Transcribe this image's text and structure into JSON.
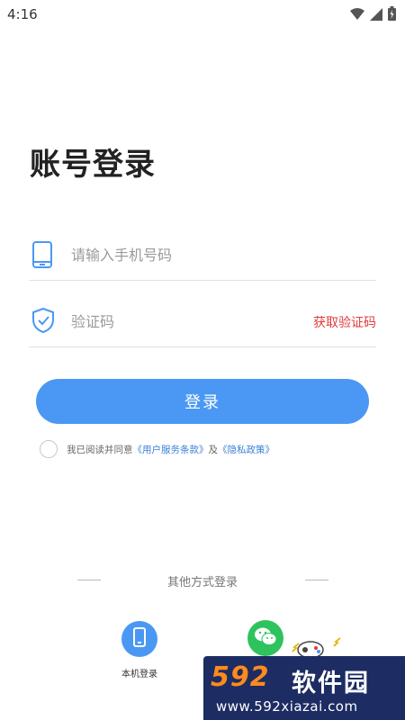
{
  "status_bar": {
    "time": "4:16"
  },
  "page": {
    "title": "账号登录"
  },
  "phone_field": {
    "placeholder": "请输入手机号码",
    "value": ""
  },
  "code_field": {
    "placeholder": "验证码",
    "value": "",
    "get_code_label": "获取验证码"
  },
  "login_button": {
    "label": "登录"
  },
  "agreement": {
    "prefix": "我已阅读并同意",
    "terms_link": "《用户服务条款》",
    "conjunction": "及",
    "privacy_link": "《隐私政策》"
  },
  "other_login": {
    "title": "其他方式登录",
    "options": [
      {
        "label": "本机登录",
        "icon": "phone-icon"
      },
      {
        "label": "",
        "icon": "wechat-icon"
      }
    ]
  },
  "watermark": {
    "logo": "592",
    "name": "软件园",
    "url": "www.592xiazai.com"
  },
  "colors": {
    "accent": "#4a98f3",
    "get_code": "#e23b3b",
    "wechat": "#2ec35c",
    "link": "#3a7fd8"
  }
}
